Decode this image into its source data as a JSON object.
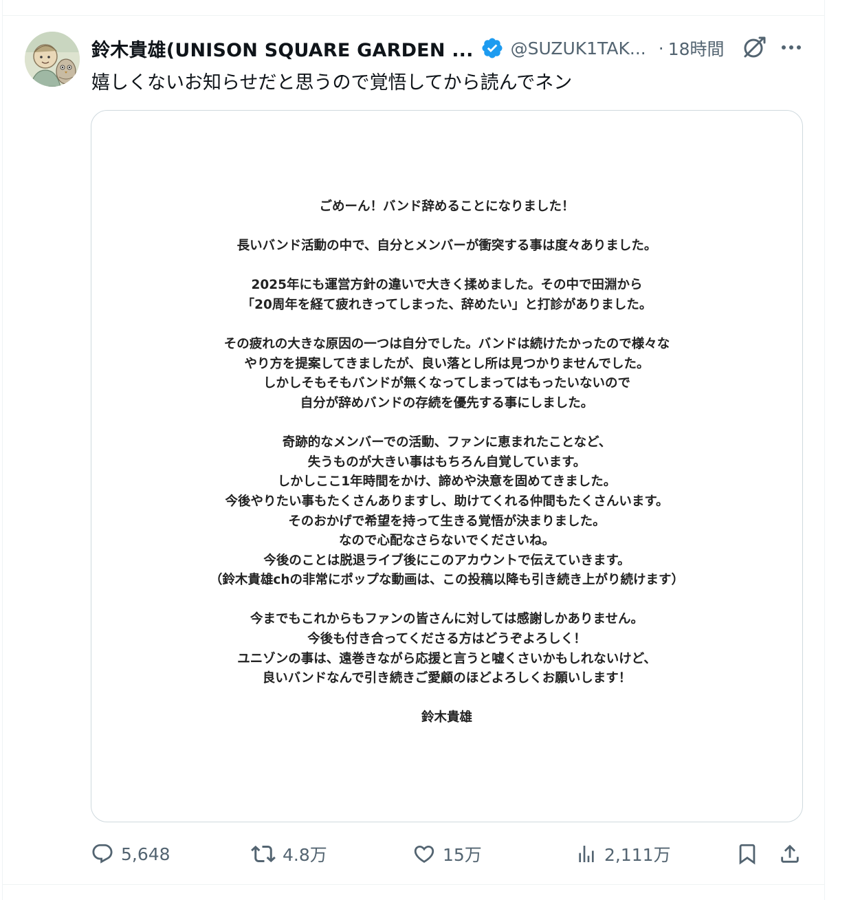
{
  "post": {
    "display_name": "鈴木貴雄(UNISON SQUARE GARDEN ...",
    "handle": "@SUZUK1TAK...",
    "separator": "·",
    "time": "18時間",
    "text": "嬉しくないお知らせだと思うので覚悟してから読んでネン"
  },
  "icons": {
    "avatar": "avatar-illustration",
    "verified": "verified-badge-icon",
    "grok": "grok-icon",
    "more": "more-horizontal-icon",
    "reply": "reply-bubble-icon",
    "retweet": "retweet-icon",
    "like": "heart-icon",
    "views": "bar-chart-icon",
    "bookmark": "bookmark-icon",
    "share": "share-upload-icon"
  },
  "colors": {
    "text_primary": "#0f1419",
    "text_secondary": "#536471",
    "verified_blue": "#1d9bf0",
    "border": "#cfd9de"
  },
  "image_text": {
    "lines": [
      "ごめーん！バンド辞めることになりました！",
      "",
      "長いバンド活動の中で、自分とメンバーが衝突する事は度々ありました。",
      "",
      "2025年にも運営方針の違いで大きく揉めました。その中で田淵から",
      "「20周年を経て疲れきってしまった、辞めたい」と打診がありました。",
      "",
      "その疲れの大きな原因の一つは自分でした。バンドは続けたかったので様々な",
      "やり方を提案してきましたが、良い落とし所は見つかりませんでした。",
      "しかしそもそもバンドが無くなってしまってはもったいないので",
      "自分が辞めバンドの存続を優先する事にしました。",
      "",
      "奇跡的なメンバーでの活動、ファンに恵まれたことなど、",
      "失うものが大きい事はもちろん自覚しています。",
      "しかしここ1年時間をかけ、諦めや決意を固めてきました。",
      "今後やりたい事もたくさんありますし、助けてくれる仲間もたくさんいます。",
      "そのおかげで希望を持って生きる覚悟が決まりました。",
      "なので心配なさらないでくださいね。",
      "今後のことは脱退ライブ後にこのアカウントで伝えていきます。",
      "（鈴木貴雄chの非常にポップな動画は、この投稿以降も引き続き上がり続けます）",
      "",
      "今までもこれからもファンの皆さんに対しては感謝しかありません。",
      "今後も付き合ってくださる方はどうぞよろしく！",
      "ユニゾンの事は、遠巻きながら応援と言うと嘘くさいかもしれないけど、",
      "良いバンドなんで引き続きご愛顧のほどよろしくお願いします！",
      "",
      "鈴木貴雄"
    ]
  },
  "metrics": {
    "replies": "5,648",
    "retweets": "4.8万",
    "likes": "15万",
    "views": "2,111万"
  }
}
